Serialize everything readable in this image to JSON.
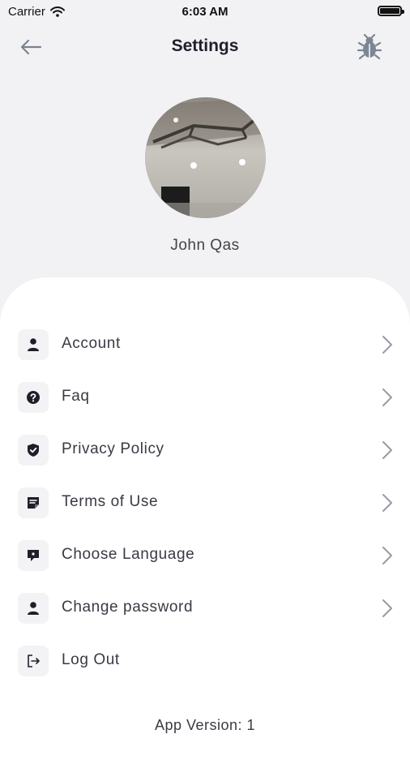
{
  "status_bar": {
    "carrier": "Carrier",
    "time": "6:03 AM"
  },
  "header": {
    "title": "Settings",
    "back_icon": "arrow-left-icon",
    "debug_icon": "bug-icon"
  },
  "profile": {
    "name": "John Qas"
  },
  "menu": {
    "items": [
      {
        "label": "Account",
        "icon": "person-icon"
      },
      {
        "label": "Faq",
        "icon": "question-circle-icon"
      },
      {
        "label": "Privacy Policy",
        "icon": "shield-check-icon"
      },
      {
        "label": "Terms of Use",
        "icon": "note-icon"
      },
      {
        "label": "Choose Language",
        "icon": "chat-bubble-icon"
      },
      {
        "label": "Change password",
        "icon": "person-icon"
      },
      {
        "label": "Log Out",
        "icon": "logout-icon"
      }
    ]
  },
  "footer": {
    "app_version": "App Version: 1"
  },
  "colors": {
    "background": "#f2f2f4",
    "card": "#ffffff",
    "icon_box": "#f3f3f6",
    "icon": "#1f1f2a",
    "chevron": "#9a9aa4"
  }
}
